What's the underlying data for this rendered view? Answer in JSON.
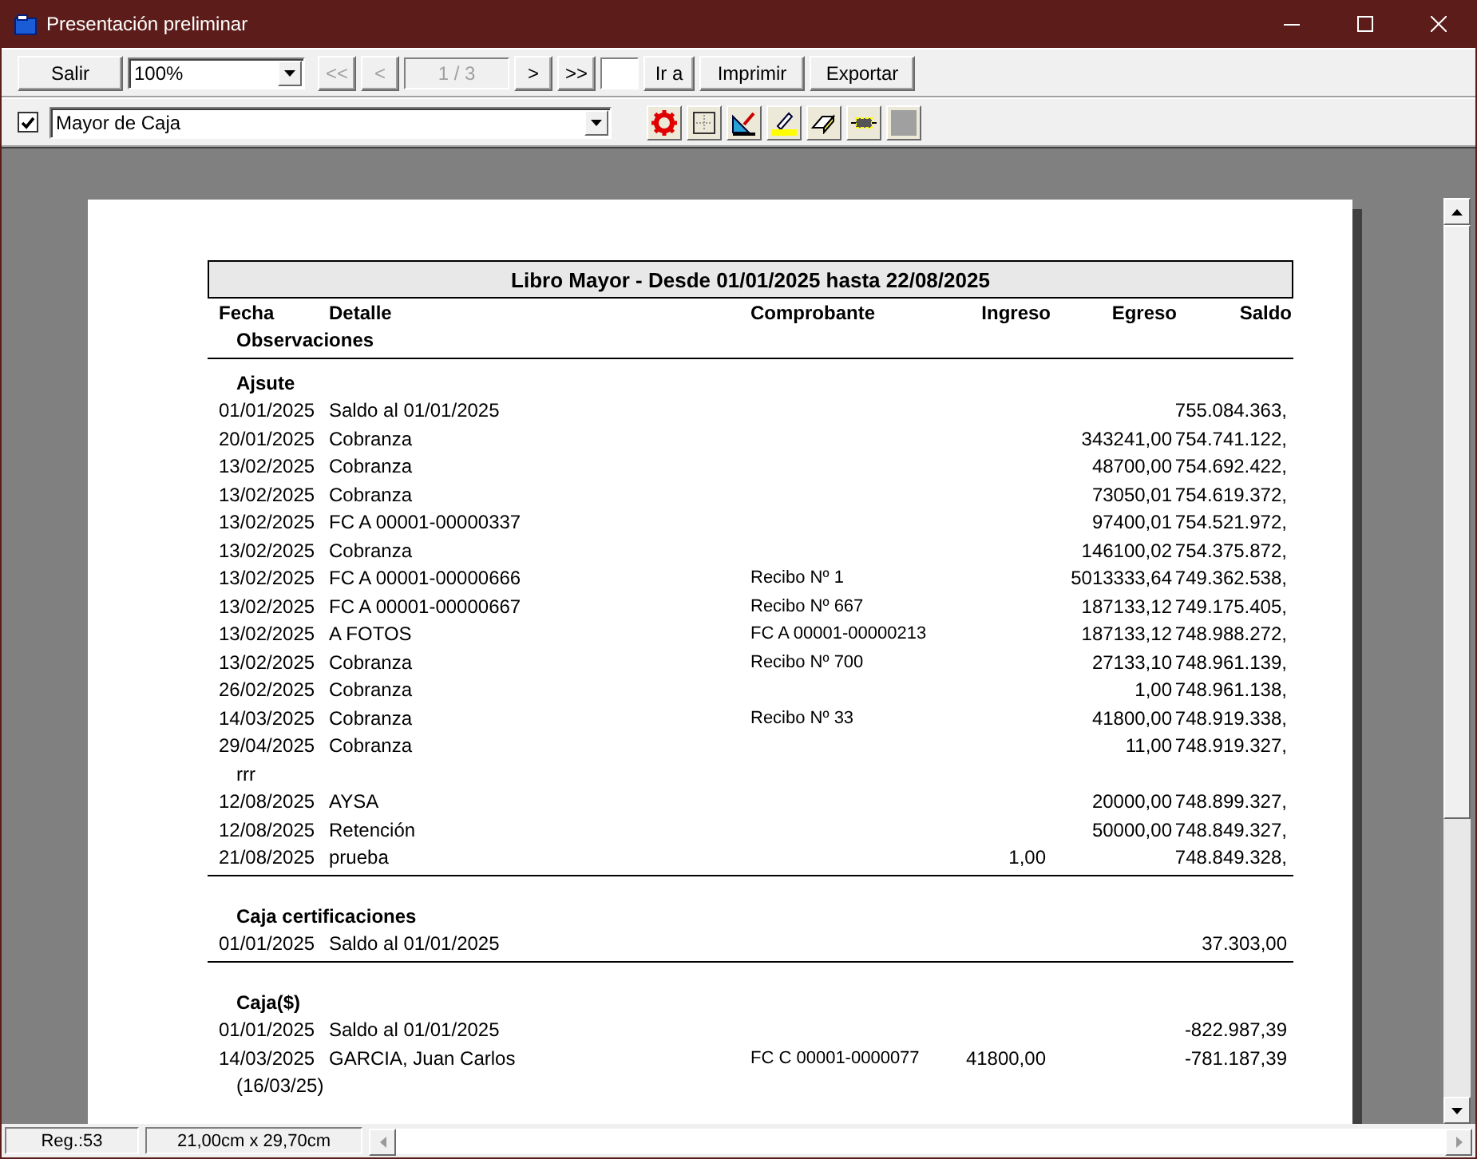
{
  "window": {
    "title": "Presentación preliminar"
  },
  "toolbar": {
    "exit": "Salir",
    "zoom": "100%",
    "nav_back": [
      {
        "label": "<<",
        "disabled": true
      },
      {
        "label": "<",
        "disabled": true
      }
    ],
    "page": "1 / 3",
    "nav_forward": [
      {
        "label": ">",
        "disabled": false
      },
      {
        "label": ">>",
        "disabled": false
      }
    ],
    "buttons": [
      "Ir a",
      "Imprimir",
      "Exportar"
    ]
  },
  "report_bar": {
    "checked": true,
    "report": "Mayor de Caja"
  },
  "report": {
    "title": "Libro Mayor - Desde 01/01/2025 hasta 22/08/2025",
    "columns": [
      "Fecha",
      "Detalle",
      "Comprobante",
      "Ingreso",
      "Egreso",
      "Saldo"
    ],
    "subheader": "Observaciones",
    "sections": [
      {
        "name": "Ajsute",
        "rows": [
          {
            "fecha": "01/01/2025",
            "detalle": "Saldo al 01/01/2025",
            "saldo": "755.084.363,"
          },
          {
            "fecha": "20/01/2025",
            "detalle": "Cobranza",
            "egreso": "343241,00",
            "saldo": "754.741.122,"
          },
          {
            "fecha": "13/02/2025",
            "detalle": "Cobranza",
            "egreso": "48700,00",
            "saldo": "754.692.422,"
          },
          {
            "fecha": "13/02/2025",
            "detalle": "Cobranza",
            "egreso": "73050,01",
            "saldo": "754.619.372,"
          },
          {
            "fecha": "13/02/2025",
            "detalle": "FC A 00001-00000337",
            "egreso": "97400,01",
            "saldo": "754.521.972,"
          },
          {
            "fecha": "13/02/2025",
            "detalle": "Cobranza",
            "egreso": "146100,02",
            "saldo": "754.375.872,"
          },
          {
            "fecha": "13/02/2025",
            "detalle": "FC A 00001-00000666",
            "comprobante": "Recibo Nº 1",
            "egreso": "5013333,64",
            "saldo": "749.362.538,"
          },
          {
            "fecha": "13/02/2025",
            "detalle": "FC A 00001-00000667",
            "comprobante": "Recibo Nº 667",
            "egreso": "187133,12",
            "saldo": "749.175.405,"
          },
          {
            "fecha": "13/02/2025",
            "detalle": "A FOTOS",
            "comprobante": "FC A  00001-00000213",
            "egreso": "187133,12",
            "saldo": "748.988.272,"
          },
          {
            "fecha": "13/02/2025",
            "detalle": "Cobranza",
            "comprobante": "Recibo Nº 700",
            "egreso": "27133,10",
            "saldo": "748.961.139,"
          },
          {
            "fecha": "26/02/2025",
            "detalle": "Cobranza",
            "egreso": "1,00",
            "saldo": "748.961.138,"
          },
          {
            "fecha": "14/03/2025",
            "detalle": "Cobranza",
            "comprobante": "Recibo Nº 33",
            "egreso": "41800,00",
            "saldo": "748.919.338,"
          },
          {
            "fecha": "29/04/2025",
            "detalle": "Cobranza",
            "egreso": "11,00",
            "saldo": "748.919.327,",
            "observaciones": "rrr"
          },
          {
            "fecha": "12/08/2025",
            "detalle": "AYSA",
            "egreso": "20000,00",
            "saldo": "748.899.327,"
          },
          {
            "fecha": "12/08/2025",
            "detalle": "Retención",
            "egreso": "50000,00",
            "saldo": "748.849.327,"
          },
          {
            "fecha": "21/08/2025",
            "detalle": "prueba",
            "ingreso": "1,00",
            "saldo": "748.849.328,"
          }
        ]
      },
      {
        "name": "Caja certificaciones",
        "rows": [
          {
            "fecha": "01/01/2025",
            "detalle": "Saldo al 01/01/2025",
            "saldo": "37.303,00"
          }
        ]
      },
      {
        "name": "Caja($)",
        "rows": [
          {
            "fecha": "01/01/2025",
            "detalle": "Saldo al 01/01/2025",
            "saldo": "-822.987,39"
          },
          {
            "fecha": "14/03/2025",
            "detalle": "GARCIA, Juan Carlos",
            "comprobante": "FC C  00001-0000077",
            "ingreso": "41800,00",
            "saldo": "-781.187,39",
            "observaciones": "(16/03/25)"
          }
        ]
      }
    ]
  },
  "status_bar": [
    "Reg.:53",
    "21,00cm x 29,70cm"
  ]
}
